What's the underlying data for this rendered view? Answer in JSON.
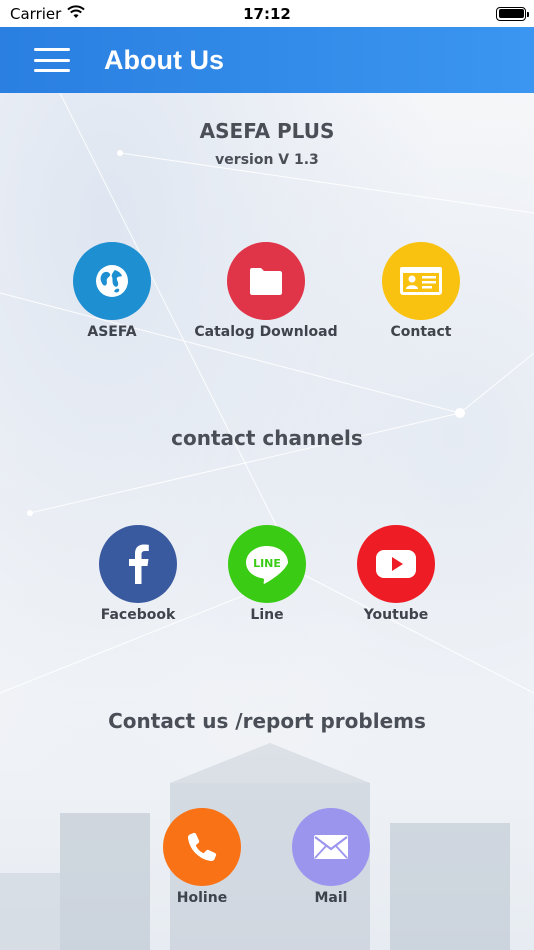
{
  "status_bar": {
    "carrier": "Carrier",
    "time": "17:12",
    "wifi_icon": "wifi-icon",
    "battery_icon": "battery-icon"
  },
  "app_bar": {
    "menu_icon": "hamburger-menu-icon",
    "title": "About Us",
    "color": "#2F8BE8"
  },
  "app_info": {
    "name": "ASEFA PLUS",
    "version": "version V 1.3"
  },
  "top_links": [
    {
      "label": "ASEFA",
      "icon": "globe-icon",
      "color": "#1E8FD0"
    },
    {
      "label": "Catalog Download",
      "icon": "folder-icon",
      "color": "#E03548"
    },
    {
      "label": "Contact",
      "icon": "contact-card-icon",
      "color": "#F9C210"
    }
  ],
  "channels": {
    "title": "contact channels",
    "items": [
      {
        "label": "Facebook",
        "icon": "facebook-icon",
        "color": "#3A5AA0"
      },
      {
        "label": "Line",
        "icon": "line-icon",
        "color": "#3ACB14"
      },
      {
        "label": "Youtube",
        "icon": "youtube-icon",
        "color": "#EE1C24"
      }
    ]
  },
  "report": {
    "title": "Contact us /report problems",
    "items": [
      {
        "label": "Holine",
        "icon": "phone-icon",
        "color": "#F97216"
      },
      {
        "label": "Mail",
        "icon": "mail-icon",
        "color": "#9B95EE"
      }
    ]
  }
}
